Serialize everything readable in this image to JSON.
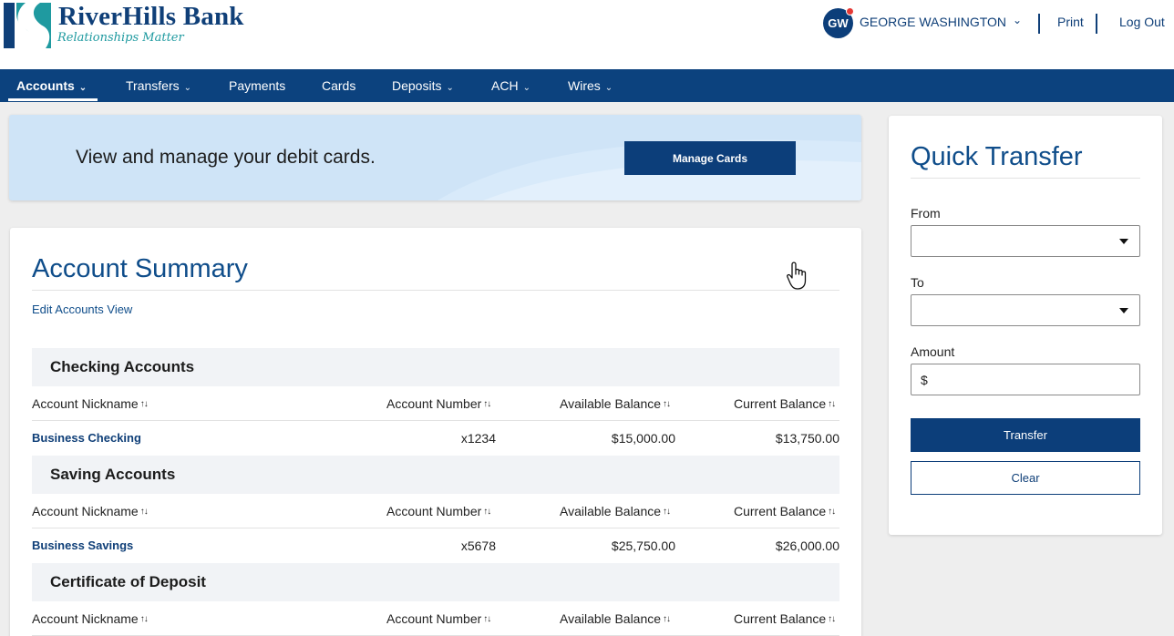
{
  "brand": {
    "name": "RiverHills Bank",
    "tagline": "Relationships Matter",
    "colors": {
      "primary": "#0c427e",
      "accent": "#1f9aa0",
      "banner": "#cfe4f7"
    }
  },
  "user": {
    "initials": "GW",
    "name": "GEORGE WASHINGTON",
    "menu_icon": "chevron-down-icon",
    "notification_dot_color": "#e53935"
  },
  "header_links": {
    "print": "Print",
    "logout": "Log Out"
  },
  "nav": {
    "items": [
      {
        "label": "Accounts",
        "dropdown": true,
        "active": true
      },
      {
        "label": "Transfers",
        "dropdown": true
      },
      {
        "label": "Payments",
        "dropdown": false
      },
      {
        "label": "Cards",
        "dropdown": false
      },
      {
        "label": "Deposits",
        "dropdown": true
      },
      {
        "label": "ACH",
        "dropdown": true
      },
      {
        "label": "Wires",
        "dropdown": true
      }
    ]
  },
  "banner": {
    "text": "View and manage your debit cards.",
    "button": "Manage Cards"
  },
  "summary": {
    "title": "Account Summary",
    "edit_link": "Edit Accounts View",
    "columns": {
      "nickname": "Account Nickname",
      "number": "Account Number",
      "available": "Available Balance",
      "current": "Current Balance",
      "sort_icon": "sort-arrows-icon"
    },
    "sections": [
      {
        "title": "Checking Accounts",
        "rows": [
          {
            "nickname": "Business Checking",
            "number": "x1234",
            "available": "$15,000.00",
            "current": "$13,750.00"
          }
        ]
      },
      {
        "title": "Saving Accounts",
        "rows": [
          {
            "nickname": "Business Savings",
            "number": "x5678",
            "available": "$25,750.00",
            "current": "$26,000.00"
          }
        ]
      },
      {
        "title": "Certificate of Deposit",
        "rows": []
      }
    ]
  },
  "quick_transfer": {
    "title": "Quick Transfer",
    "from_label": "From",
    "from_value": "",
    "to_label": "To",
    "to_value": "",
    "amount_label": "Amount",
    "amount_prefix": "$",
    "transfer_button": "Transfer",
    "clear_button": "Clear"
  }
}
